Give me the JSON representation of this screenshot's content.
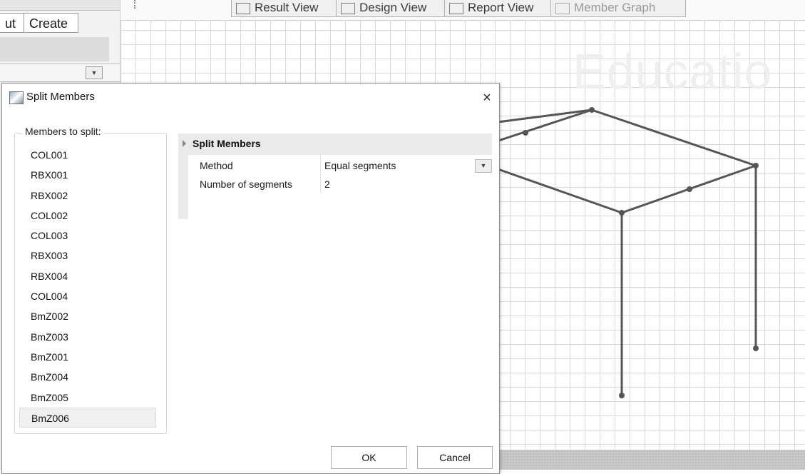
{
  "left_panel": {
    "tab_partial": "ut",
    "tab_create": "Create"
  },
  "toolbar": {
    "views": [
      {
        "label": "Result View",
        "icon": "result-view-icon"
      },
      {
        "label": "Design View",
        "icon": "design-view-icon"
      },
      {
        "label": "Report View",
        "icon": "report-view-icon"
      },
      {
        "label": "Member Graph",
        "icon": "member-graph-icon"
      }
    ]
  },
  "watermark": "Educatio",
  "dialog": {
    "title": "Split Members",
    "close_glyph": "×",
    "members_label": "Members to split:",
    "members": [
      "COL001",
      "RBX001",
      "RBX002",
      "COL002",
      "COL003",
      "RBX003",
      "RBX004",
      "COL004",
      "BmZ002",
      "BmZ003",
      "BmZ001",
      "BmZ004",
      "BmZ005",
      "BmZ006"
    ],
    "selected_member": "BmZ006",
    "properties": {
      "category": "Split Members",
      "rows": [
        {
          "name": "Method",
          "value": "Equal segments"
        },
        {
          "name": "Number of segments",
          "value": "2"
        }
      ]
    },
    "ok_label": "OK",
    "cancel_label": "Cancel"
  },
  "colors": {
    "grid_line": "#d9d9d9",
    "model_line": "#555555",
    "dialog_border": "#8a8a8a",
    "header_bg": "#eaeaea"
  }
}
